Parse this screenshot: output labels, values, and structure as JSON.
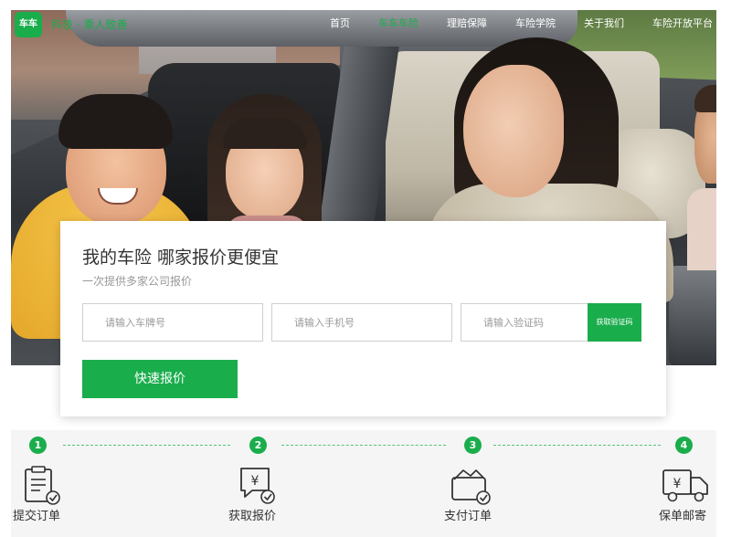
{
  "header": {
    "logo_text": "车车",
    "slogan": "科技 · 乘人致善",
    "nav": [
      {
        "label": "首页",
        "active": false
      },
      {
        "label": "车车车险",
        "active": true
      },
      {
        "label": "理赔保障",
        "active": false
      },
      {
        "label": "车险学院",
        "active": false
      },
      {
        "label": "关于我们",
        "active": false
      },
      {
        "label": "车险开放平台",
        "active": false
      }
    ]
  },
  "quote": {
    "title": "我的车险 哪家报价更便宜",
    "subtitle": "一次提供多家公司报价",
    "plate_placeholder": "请输入车牌号",
    "phone_placeholder": "请输入手机号",
    "code_placeholder": "请输入验证码",
    "get_code_label": "获取验证码",
    "submit_label": "快速报价"
  },
  "steps": [
    {
      "num": "1",
      "label": "提交订单",
      "icon": "order-form-icon"
    },
    {
      "num": "2",
      "label": "获取报价",
      "icon": "price-quote-icon"
    },
    {
      "num": "3",
      "label": "支付订单",
      "icon": "wallet-icon"
    },
    {
      "num": "4",
      "label": "保单邮寄",
      "icon": "delivery-truck-icon"
    }
  ],
  "colors": {
    "brand_green": "#1aad4c",
    "card_bg": "#ffffff",
    "steps_bg": "#f5f5f5"
  }
}
